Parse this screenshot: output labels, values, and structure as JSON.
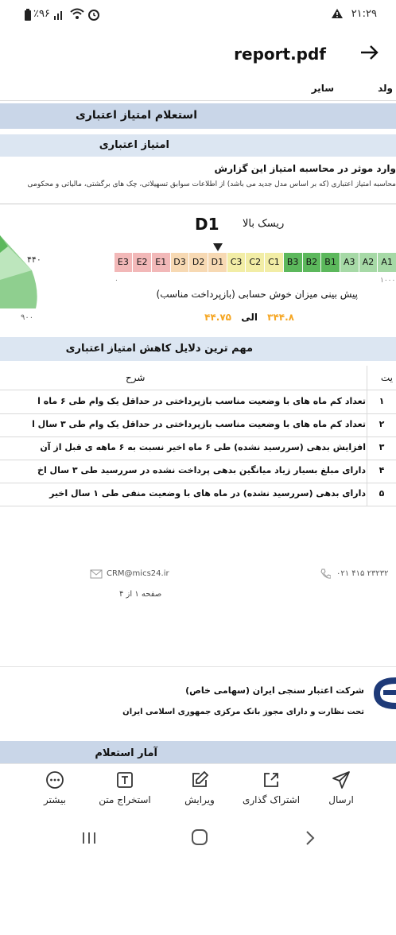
{
  "status_bar": {
    "time": "۲۱:۲۹",
    "battery": "٪۹۶"
  },
  "app_bar": {
    "title": "report.pdf",
    "back_icon": "arrow-right-icon"
  },
  "doc": {
    "top_row": {
      "right_text": "ولد",
      "left_text": "سایر"
    },
    "section1_title": "استعلام امتیاز اعتباری",
    "section1_sub": "امتیاز اعتباری",
    "factors_title": "وارد موثر در محاسبه امتیاز این گزارش",
    "factors_desc": "محاسبه امتیاز اعتباری (که بر اساس مدل جدید می باشد) از اطلاعات سوابق تسهیلاتی، چک های برگشتی، مالیاتی و محکومی",
    "grade": "D1",
    "risk_label": "ریسک بالا",
    "gauge_number": "۴۴۰",
    "gauge_bottom": "۹۰۰",
    "scale_cells": [
      {
        "label": "A1",
        "color": "#a6d9a6"
      },
      {
        "label": "A2",
        "color": "#a6d9a6"
      },
      {
        "label": "A3",
        "color": "#a6d9a6"
      },
      {
        "label": "B1",
        "color": "#5cb85c"
      },
      {
        "label": "B2",
        "color": "#5cb85c"
      },
      {
        "label": "B3",
        "color": "#5cb85c"
      },
      {
        "label": "C1",
        "color": "#f2eda6"
      },
      {
        "label": "C2",
        "color": "#f2eda6"
      },
      {
        "label": "C3",
        "color": "#f2eda6"
      },
      {
        "label": "D1",
        "color": "#f7d9b3"
      },
      {
        "label": "D2",
        "color": "#f7d9b3"
      },
      {
        "label": "D3",
        "color": "#f7d9b3"
      },
      {
        "label": "E1",
        "color": "#f2b8b8"
      },
      {
        "label": "E2",
        "color": "#f2b8b8"
      },
      {
        "label": "E3",
        "color": "#f2b8b8"
      }
    ],
    "scale_min": "۰",
    "scale_max": "۱۰۰۰",
    "forecast_label": "پیش بینی میزان خوش حسابی (بازپرداخت مناسب)",
    "forecast_from": "۳۴۴.۸",
    "forecast_to_word": "الی",
    "forecast_to": "۴۴.۷۵",
    "reasons_title": "مهم ترین دلایل کاهش امتیاز اعتباری",
    "table_header_num": "یت",
    "table_header_desc": "شرح",
    "rows": [
      {
        "num": "۱",
        "text": "تعداد کم ماه های با وضعیت مناسب بازپرداختی در حداقل یک وام طی ۶ ماه ا"
      },
      {
        "num": "۲",
        "text": "تعداد کم ماه های با وضعیت مناسب بازپرداختی در حداقل یک وام طی ۳ سال ا"
      },
      {
        "num": "۳",
        "text": "افزایش بدهی (سررسید نشده) طی ۶ ماه اخیر نسبت به ۶ ماهه ی قبل از آن"
      },
      {
        "num": "۴",
        "text": "دارای مبلغ بسیار زیاد میانگین بدهی پرداخت نشده در سررسید طی ۳ سال اخ"
      },
      {
        "num": "۵",
        "text": "دارای بدهی (سررسید نشده) در ماه های با وضعیت منفی طی ۱ سال اخیر"
      }
    ],
    "footer_email": "CRM@mics24.ir",
    "footer_phone": "۰۲۱ ۴۱۵ ۲۳۲۳۲",
    "footer_page": "صفحه ۱ از ۴",
    "company_name": "شرکت اعتبار سنجی ایران (سهامی خاص)",
    "company_sub": "تحت نظارت و دارای مجوز بانک مرکزی جمهوری اسلامی ایران",
    "section2_title": "آمار استعلام"
  },
  "toolbar": {
    "send": "ارسال",
    "share": "اشتراک گذاری",
    "edit": "ویرایش",
    "extract": "استخراج متن",
    "more": "بیشتر"
  },
  "colors": {
    "header_dark": "#c9d6e8",
    "header_light": "#dce6f2",
    "grade_orange": "#f5a623"
  }
}
